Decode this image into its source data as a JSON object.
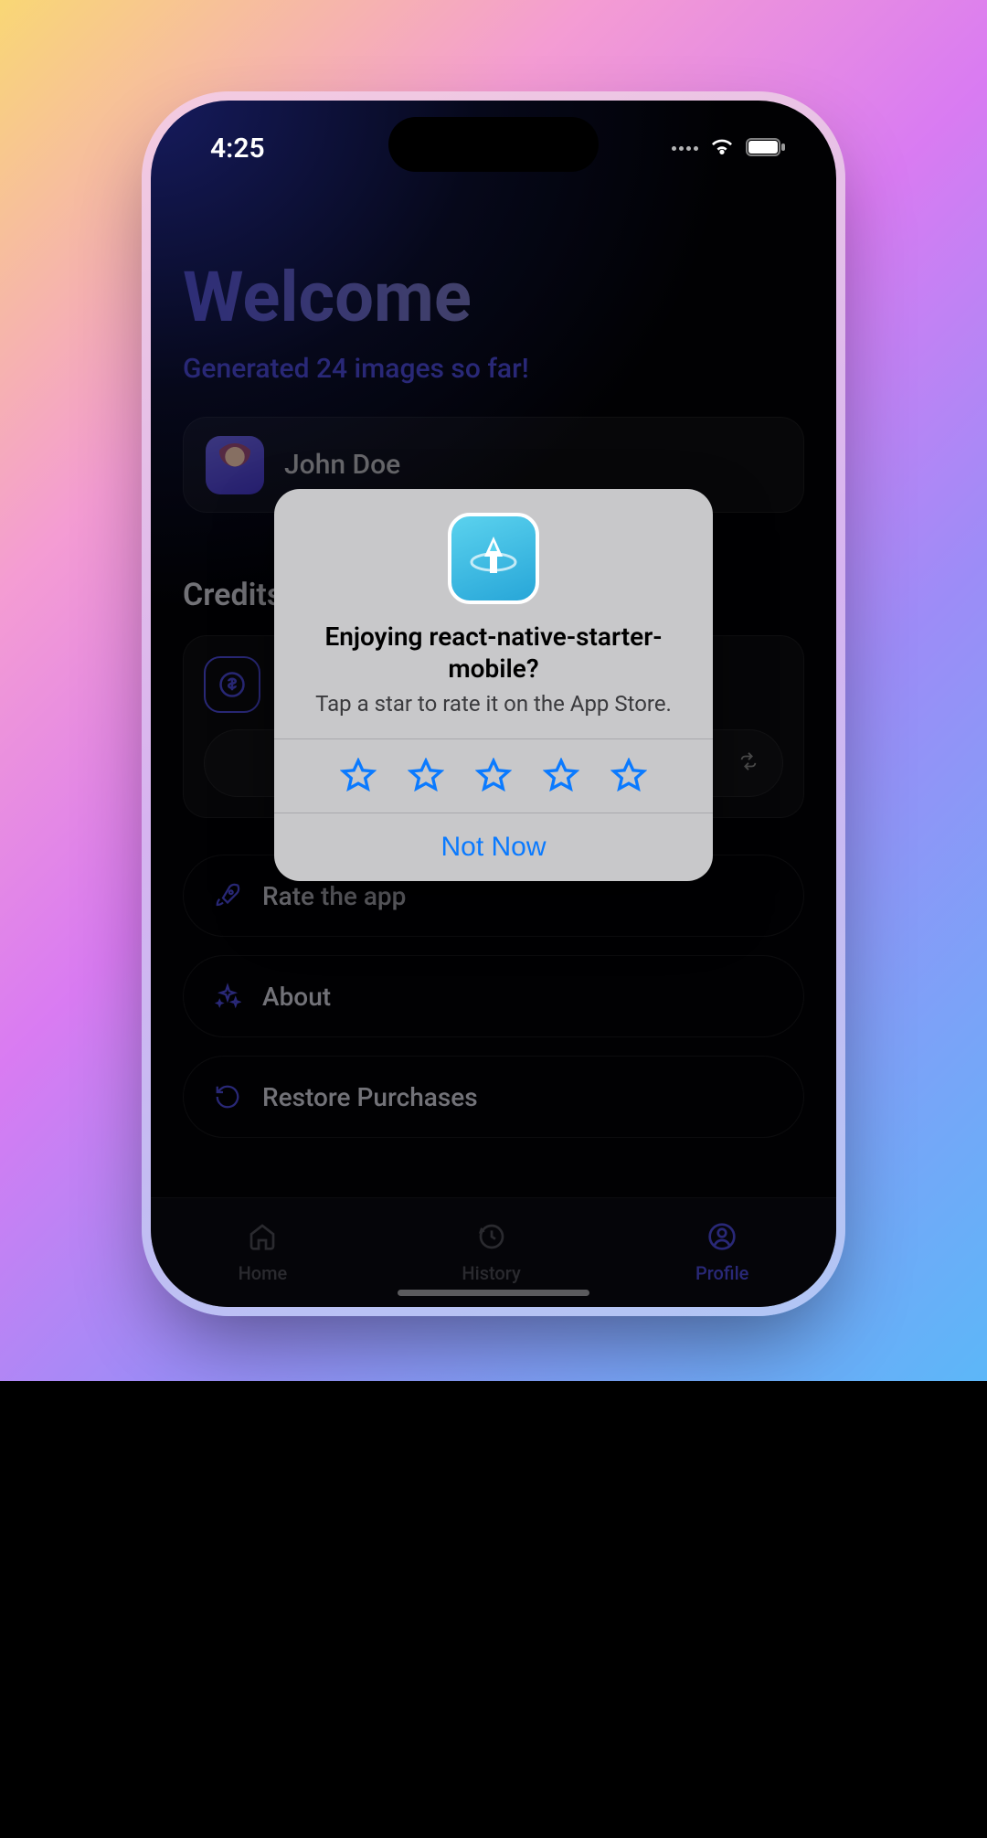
{
  "status_bar": {
    "time": "4:25"
  },
  "header": {
    "welcome": "Welcome",
    "subtext": "Generated 24 images so far!"
  },
  "user": {
    "name": "John Doe"
  },
  "credits": {
    "section_title": "Credits"
  },
  "menu": {
    "rate": "Rate the app",
    "about": "About",
    "restore": "Restore Purchases"
  },
  "tabs": {
    "home": "Home",
    "history": "History",
    "profile": "Profile"
  },
  "rating_dialog": {
    "title": "Enjoying react-native-starter-mobile?",
    "subtitle": "Tap a star to rate it on the App Store.",
    "not_now": "Not Now",
    "star_count": 5
  }
}
